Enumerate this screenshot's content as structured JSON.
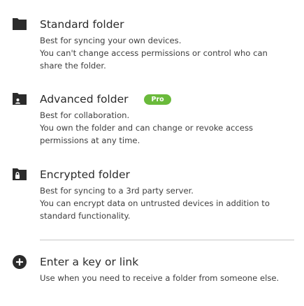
{
  "options": [
    {
      "title": "Standard folder",
      "icon": "folder-icon",
      "lines": [
        "Best for syncing your own devices.",
        "You can't change access permissions or control who can",
        "share the folder."
      ]
    },
    {
      "title": "Advanced folder",
      "badge": "Pro",
      "icon": "advanced-folder-icon",
      "lines": [
        "Best for collaboration.",
        "You own the folder and can change or revoke access",
        "permissions at any time."
      ]
    },
    {
      "title": "Encrypted folder",
      "icon": "encrypted-folder-icon",
      "lines": [
        "Best for syncing to a 3rd party server.",
        "You can encrypt data on untrusted devices in addition to",
        "standard functionality."
      ]
    },
    {
      "title": "Enter a key or link",
      "icon": "add-circle-icon",
      "lines": [
        "Use when you need to receive a folder from someone else."
      ]
    }
  ],
  "colors": {
    "icon": "#2b2b2b",
    "badge_bg": "#6aba3b",
    "divider": "#c8c8c8"
  }
}
